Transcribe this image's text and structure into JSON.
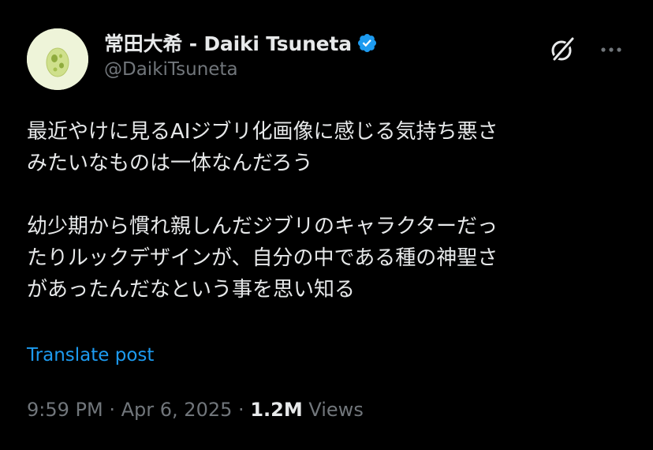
{
  "author": {
    "display_name": "常田大希 - Daiki Tsuneta",
    "handle": "@DaikiTsuneta",
    "verified": true,
    "avatar_icon": "egg-avatar-icon"
  },
  "actions": {
    "grok_icon": "grok-icon",
    "more_icon": "more-options-icon"
  },
  "post": {
    "text": "最近やけに見るAIジブリ化画像に感じる気持ち悪さ\nみたいなものは一体なんだろう\n\n幼少期から慣れ親しんだジブリのキャラクターだっ\nたりルックデザインが、自分の中である種の神聖さ\nがあったんだなという事を思い知る",
    "translate_label": "Translate post"
  },
  "meta": {
    "time": "9:59 PM",
    "separator": "·",
    "date": "Apr 6, 2025",
    "views_count": "1.2M",
    "views_label": "Views"
  },
  "colors": {
    "background": "#000000",
    "text_primary": "#e7e9ea",
    "text_secondary": "#71767b",
    "link": "#1d9bf0",
    "verified_badge": "#1d9bf0",
    "avatar_bg": "#eef4d9"
  }
}
